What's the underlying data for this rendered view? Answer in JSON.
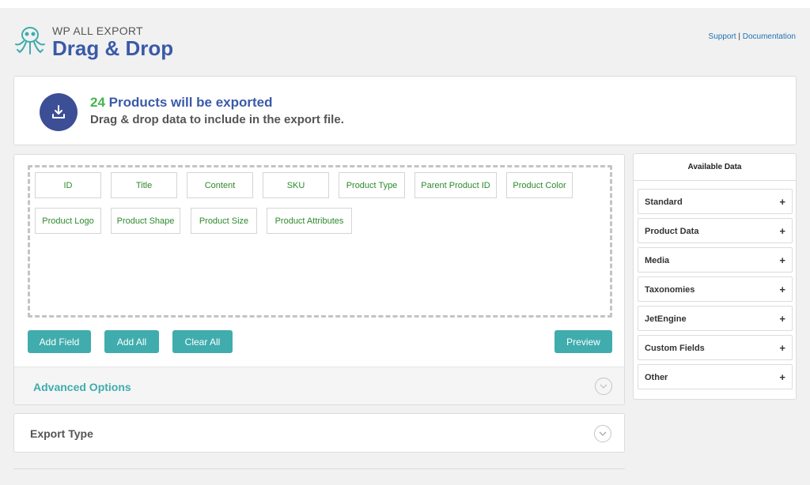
{
  "header": {
    "brand_small": "WP ALL EXPORT",
    "brand_big": "Drag & Drop",
    "support_label": "Support",
    "separator": "|",
    "documentation_label": "Documentation"
  },
  "summary": {
    "count": "24",
    "count_suffix": " Products will be exported",
    "subtitle": "Drag & drop data to include in the export file."
  },
  "fields": [
    "ID",
    "Title",
    "Content",
    "SKU",
    "Product Type",
    "Parent Product ID",
    "Product Color",
    "Product Logo",
    "Product Shape",
    "Product Size",
    "Product Attributes"
  ],
  "buttons": {
    "add_field": "Add Field",
    "add_all": "Add All",
    "clear_all": "Clear All",
    "preview": "Preview"
  },
  "advanced_options_label": "Advanced Options",
  "export_type_label": "Export Type",
  "sidebar": {
    "title": "Available Data",
    "items": [
      {
        "label": "Standard",
        "icon": "plus-icon"
      },
      {
        "label": "Product Data",
        "icon": "plus-icon"
      },
      {
        "label": "Media",
        "icon": "plus-icon"
      },
      {
        "label": "Taxonomies",
        "icon": "plus-icon"
      },
      {
        "label": "JetEngine",
        "icon": "plus-icon"
      },
      {
        "label": "Custom Fields",
        "icon": "plus-icon"
      },
      {
        "label": "Other",
        "icon": "plus-icon"
      }
    ],
    "plus_symbol": "+"
  },
  "colors": {
    "accent_teal": "#40acad",
    "brand_blue": "#3a5aa8",
    "count_green": "#46b450",
    "field_text_green": "#2d8a2d"
  }
}
